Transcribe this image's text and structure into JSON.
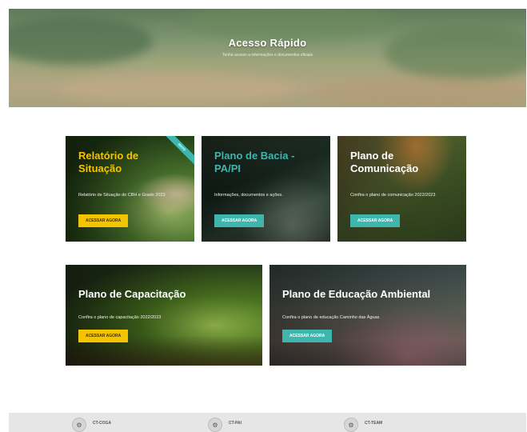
{
  "hero": {
    "title": "Acesso Rápido",
    "subtitle": "Tenha acesso a informações e documentos oficiais"
  },
  "cards": [
    {
      "title": "Relatório de Situação",
      "desc": "Relatório de Situação do CBH e Grade 2023",
      "button": "ACESSAR AGORA",
      "ribbon": "NOVO"
    },
    {
      "title": "Plano de Bacia - PA/PI",
      "desc": "Informações, documentos e ações.",
      "button": "ACESSAR AGORA"
    },
    {
      "title": "Plano de Comunicação",
      "desc": "Confira o plano de comunicação 2022/2023",
      "button": "ACESSAR AGORA"
    },
    {
      "title": "Plano de Capacitação",
      "desc": "Confira o plano de capacitação 2022/2023",
      "button": "ACESSAR AGORA"
    },
    {
      "title": "Plano de Educação Ambiental",
      "desc": "Confira o plano de educação Caminho das Águas",
      "button": "ACESSAR AGORA"
    }
  ],
  "footer": {
    "items": [
      {
        "name": "CT-COGA",
        "icon": "seal-icon"
      },
      {
        "name": "CT-PAI",
        "icon": "seal-icon"
      },
      {
        "name": "CT-TEAM",
        "icon": "seal-icon"
      }
    ]
  },
  "colors": {
    "accent_yellow": "#f5c400",
    "accent_teal": "#3eb6ad",
    "footer_bg": "#e6e6e6"
  }
}
